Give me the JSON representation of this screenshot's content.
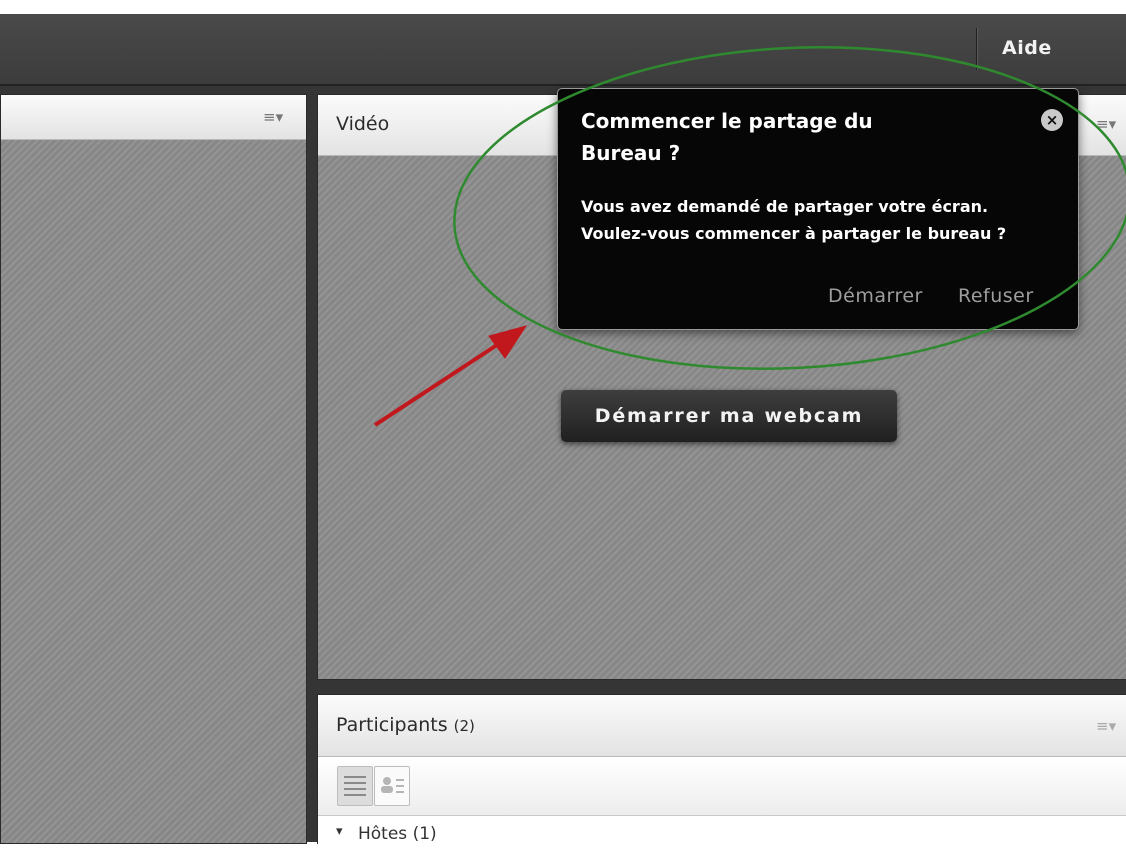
{
  "topbar": {
    "help_label": "Aide"
  },
  "left_pod": {
    "menu_icon": "≡▾"
  },
  "video_pod": {
    "title": "Vidéo",
    "menu_icon": "≡▾",
    "webcam_button": "Démarrer ma webcam"
  },
  "share_popup": {
    "title_line1": "Commencer le partage du",
    "title_line2": "Bureau ?",
    "message_line1": "Vous avez demandé de partager votre écran.",
    "message_line2": "Voulez-vous commencer à partager le bureau ?",
    "start_label": "Démarrer",
    "decline_label": "Refuser",
    "close_icon": "×"
  },
  "participants_pod": {
    "title": "Participants",
    "count": "(2)",
    "menu_icon": "≡▾",
    "hosts_group": "Hôtes (1)",
    "expand_icon": "▾"
  },
  "annotations": {
    "highlight_color": "#2f8a2f",
    "arrow_color": "#c0181d"
  }
}
